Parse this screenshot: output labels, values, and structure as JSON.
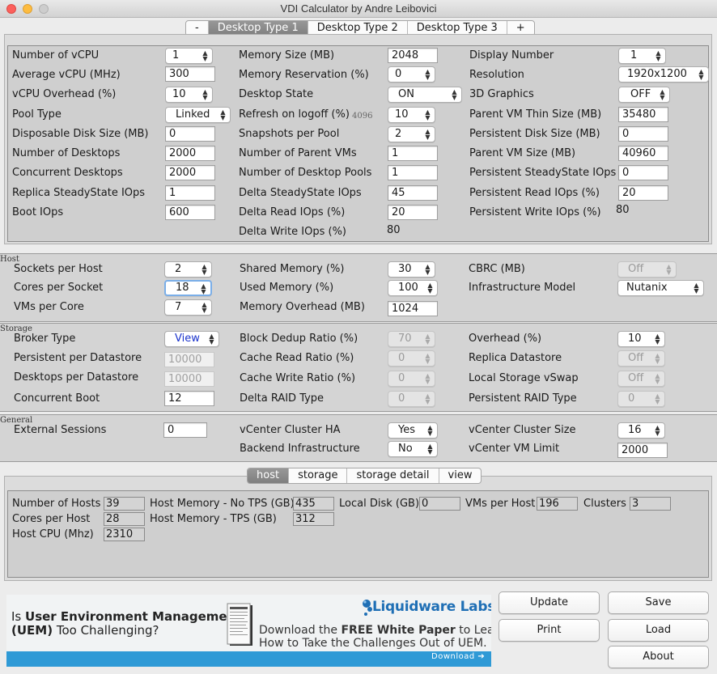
{
  "window": {
    "title": "VDI Calculator by Andre Leibovici"
  },
  "top_tabs": {
    "minus": "-",
    "type1": "Desktop Type 1",
    "type2": "Desktop Type 2",
    "type3": "Desktop Type 3",
    "plus": "+"
  },
  "desktop": {
    "vcpu_label": "Number of vCPU",
    "vcpu_value": "1",
    "avg_vcpu_label": "Average vCPU (MHz)",
    "avg_vcpu_value": "300",
    "vcpu_overhead_label": "vCPU Overhead (%)",
    "vcpu_overhead_value": "10",
    "pool_type_label": "Pool Type",
    "pool_type_value": "Linked",
    "disposable_label": "Disposable Disk Size (MB)",
    "disposable_value": "0",
    "num_desktops_label": "Number of Desktops",
    "num_desktops_value": "2000",
    "concurrent_label": "Concurrent Desktops",
    "concurrent_value": "2000",
    "replica_iops_label": "Replica SteadyState IOps",
    "replica_iops_value": "1",
    "boot_iops_label": "Boot IOps",
    "boot_iops_value": "600",
    "memory_label": "Memory Size (MB)",
    "memory_value": "2048",
    "mem_res_label": "Memory Reservation (%)",
    "mem_res_value": "0",
    "desktop_state_label": "Desktop State",
    "desktop_state_value": "ON",
    "refresh_label": "Refresh on logoff (%)",
    "refresh_hint": "4096",
    "refresh_value": "10",
    "snapshots_label": "Snapshots per Pool",
    "snapshots_value": "2",
    "parent_vms_label": "Number of Parent VMs",
    "parent_vms_value": "1",
    "pools_label": "Number of Desktop Pools",
    "pools_value": "1",
    "delta_iops_label": "Delta SteadyState IOps",
    "delta_iops_value": "45",
    "delta_read_label": "Delta Read IOps (%)",
    "delta_read_value": "20",
    "delta_write_label": "Delta Write IOps (%)",
    "delta_write_value": "80",
    "display_label": "Display Number",
    "display_value": "1",
    "resolution_label": "Resolution",
    "resolution_value": "1920x1200",
    "graphics_label": "3D Graphics",
    "graphics_value": "OFF",
    "thin_label": "Parent VM Thin Size (MB)",
    "thin_value": "35480",
    "persistent_disk_label": "Persistent Disk Size (MB)",
    "persistent_disk_value": "0",
    "parent_size_label": "Parent VM Size (MB)",
    "parent_size_value": "40960",
    "persistent_iops_label": "Persistent SteadyState IOps",
    "persistent_iops_value": "0",
    "persistent_read_label": "Persistent Read IOps (%)",
    "persistent_read_value": "20",
    "persistent_write_label": "Persistent Write IOps (%)",
    "persistent_write_value": "80"
  },
  "host": {
    "section_label": "Host",
    "sockets_label": "Sockets per Host",
    "sockets_value": "2",
    "cores_label": "Cores per Socket",
    "cores_value": "18",
    "vms_core_label": "VMs per Core",
    "vms_core_value": "7",
    "shared_label": "Shared Memory (%)",
    "shared_value": "30",
    "used_label": "Used Memory (%)",
    "used_value": "100",
    "overhead_label": "Memory Overhead (MB)",
    "overhead_value": "1024",
    "cbrc_label": "CBRC (MB)",
    "cbrc_value": "Off",
    "infra_label": "Infrastructure Model",
    "infra_value": "Nutanix"
  },
  "storage": {
    "section_label": "Storage",
    "broker_label": "Broker Type",
    "broker_value": "View",
    "persistent_ds_label": "Persistent per Datastore",
    "persistent_ds_value": "10000",
    "desktops_ds_label": "Desktops per Datastore",
    "desktops_ds_value": "10000",
    "boot_label": "Concurrent Boot",
    "boot_value": "12",
    "dedup_label": "Block Dedup Ratio (%)",
    "dedup_value": "70",
    "cache_read_label": "Cache Read Ratio (%)",
    "cache_read_value": "0",
    "cache_write_label": "Cache Write Ratio (%)",
    "cache_write_value": "0",
    "delta_raid_label": "Delta RAID Type",
    "delta_raid_value": "0",
    "overhead_label": "Overhead (%)",
    "overhead_value": "10",
    "replica_ds_label": "Replica Datastore",
    "replica_ds_value": "Off",
    "vswap_label": "Local Storage vSwap",
    "vswap_value": "Off",
    "persistent_raid_label": "Persistent RAID Type",
    "persistent_raid_value": "0"
  },
  "general": {
    "section_label": "General",
    "ext_label": "External Sessions",
    "ext_value": "0",
    "ha_label": "vCenter Cluster HA",
    "ha_value": "Yes",
    "backend_label": "Backend Infrastructure",
    "backend_value": "No",
    "cluster_size_label": "vCenter Cluster Size",
    "cluster_size_value": "16",
    "vm_limit_label": "vCenter VM Limit",
    "vm_limit_value": "2000"
  },
  "result_tabs": {
    "host": "host",
    "storage": "storage",
    "storage_detail": "storage detail",
    "view": "view"
  },
  "results": {
    "hosts_label": "Number of Hosts",
    "hosts_value": "39",
    "cores_label": "Cores per Host",
    "cores_value": "28",
    "cpu_label": "Host CPU (Mhz)",
    "cpu_value": "2310",
    "no_tps_label": "Host Memory - No TPS (GB)",
    "no_tps_value": "435",
    "tps_label": "Host Memory - TPS (GB)",
    "tps_value": "312",
    "disk_label": "Local Disk (GB)",
    "disk_value": "0",
    "vms_label": "VMs per Host",
    "vms_value": "196",
    "clusters_label": "Clusters",
    "clusters_value": "3"
  },
  "buttons": {
    "update": "Update",
    "save": "Save",
    "print": "Print",
    "load": "Load",
    "about": "About"
  },
  "banner": {
    "is": "Is ",
    "uem_bold": "User Environment Management",
    "uem_abbr": "(UEM)",
    "rest": " Too Challenging?",
    "brand": "Liquidware Labs",
    "tm": "™",
    "dl_pre": "Download the ",
    "dl_bold": "FREE White Paper",
    "dl_post": " to Learn",
    "dl_line2": "How to Take the Challenges Out of UEM.",
    "cta": "Download"
  },
  "colors": {
    "accent": "#1a33cc",
    "active_tab": "#8a8a8a",
    "banner_bar": "#2f9ad6",
    "brand_blue": "#1f6fb5"
  }
}
